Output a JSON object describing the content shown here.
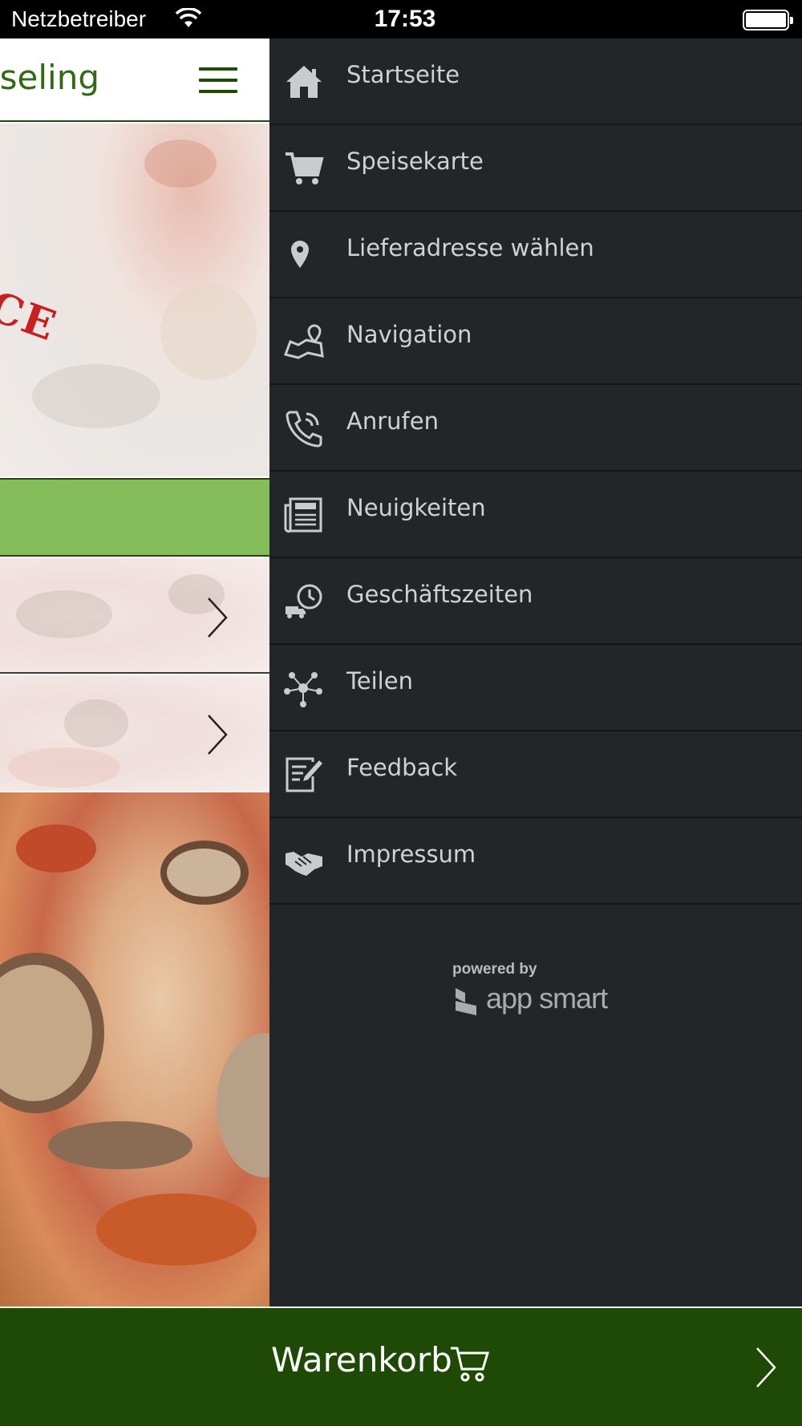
{
  "status_bar": {
    "carrier": "Netzbetreiber",
    "time": "17:53"
  },
  "header": {
    "title": "sseling",
    "menu_icon": "hamburger-icon"
  },
  "hero": {
    "stamp_text": "CE"
  },
  "menu": {
    "items": [
      {
        "label": "Startseite",
        "icon": "home-icon"
      },
      {
        "label": "Speisekarte",
        "icon": "cart-icon"
      },
      {
        "label": "Lieferadresse wählen",
        "icon": "location-pin-icon"
      },
      {
        "label": "Navigation",
        "icon": "map-icon"
      },
      {
        "label": "Anrufen",
        "icon": "phone-icon"
      },
      {
        "label": "Neuigkeiten",
        "icon": "newspaper-icon"
      },
      {
        "label": "Geschäftszeiten",
        "icon": "delivery-clock-icon"
      },
      {
        "label": "Teilen",
        "icon": "share-icon"
      },
      {
        "label": "Feedback",
        "icon": "feedback-icon"
      },
      {
        "label": "Impressum",
        "icon": "handshake-icon"
      }
    ],
    "powered_by": "powered by",
    "brand_name": "app smart"
  },
  "cart_bar": {
    "label": "Warenkorb",
    "icon": "cart-icon"
  },
  "colors": {
    "brand_green": "#1e4a06",
    "accent_green": "#85bd5a",
    "menu_background": "#232629",
    "menu_text": "#cfd2d4"
  }
}
